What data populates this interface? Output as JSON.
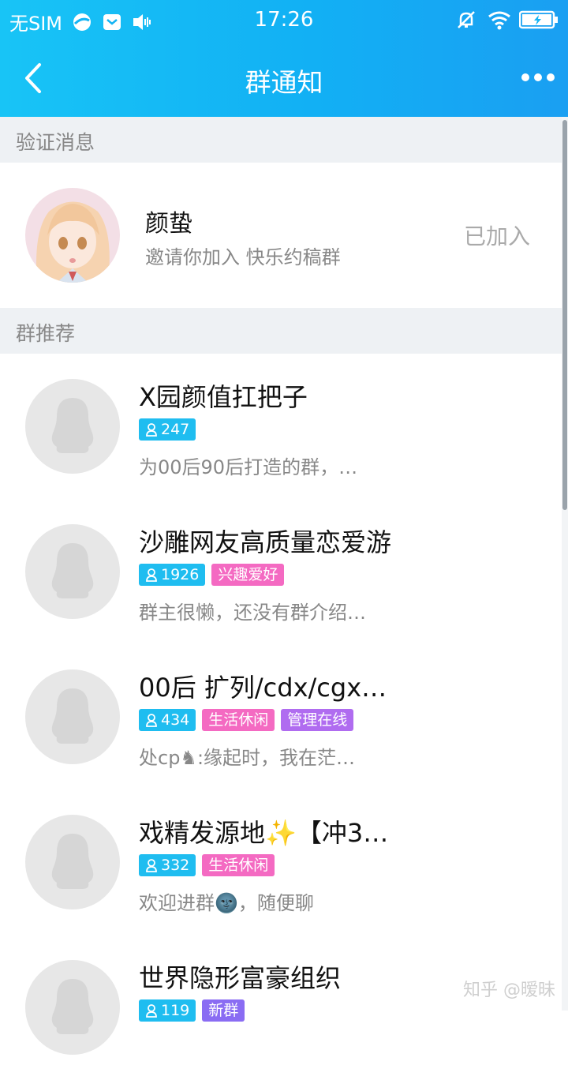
{
  "status_bar": {
    "carrier": "无SIM",
    "time": "17:26"
  },
  "header": {
    "title": "群通知",
    "back_icon": "back-arrow-icon",
    "more_icon": "more-dots-icon"
  },
  "sections": {
    "verify_title": "验证消息",
    "recommend_title": "群推荐"
  },
  "verification": {
    "name": "颜蛰",
    "message": "邀请你加入 快乐约稿群",
    "status": "已加入"
  },
  "groups": [
    {
      "name": "X园颜值扛把子",
      "count": "247",
      "tags": [],
      "desc": "为00后90后打造的群，…"
    },
    {
      "name": "沙雕网友高质量恋爱游",
      "count": "1926",
      "tags": [
        "兴趣爱好"
      ],
      "desc": "群主很懒，还没有群介绍…"
    },
    {
      "name": "00后 扩列/cdx/cgx…",
      "count": "434",
      "tags": [
        "生活休闲",
        "管理在线"
      ],
      "desc": "处cp♞:缘起时，我在茫…"
    },
    {
      "name": "戏精发源地✨【冲3…",
      "count": "332",
      "tags": [
        "生活休闲"
      ],
      "desc": "欢迎进群🌚，随便聊"
    },
    {
      "name": "世界隐形富豪组织",
      "count": "119",
      "tags": [
        "新群"
      ],
      "desc": ""
    }
  ],
  "watermark": "知乎 @暧昧",
  "colors": {
    "header_gradient_start": "#18c4f6",
    "header_gradient_end": "#1a9ff2",
    "tag_count": "#1fbdf0",
    "tag_interest": "#f46ac2",
    "tag_manage": "#b06cf0",
    "tag_new": "#8a6cf3"
  }
}
